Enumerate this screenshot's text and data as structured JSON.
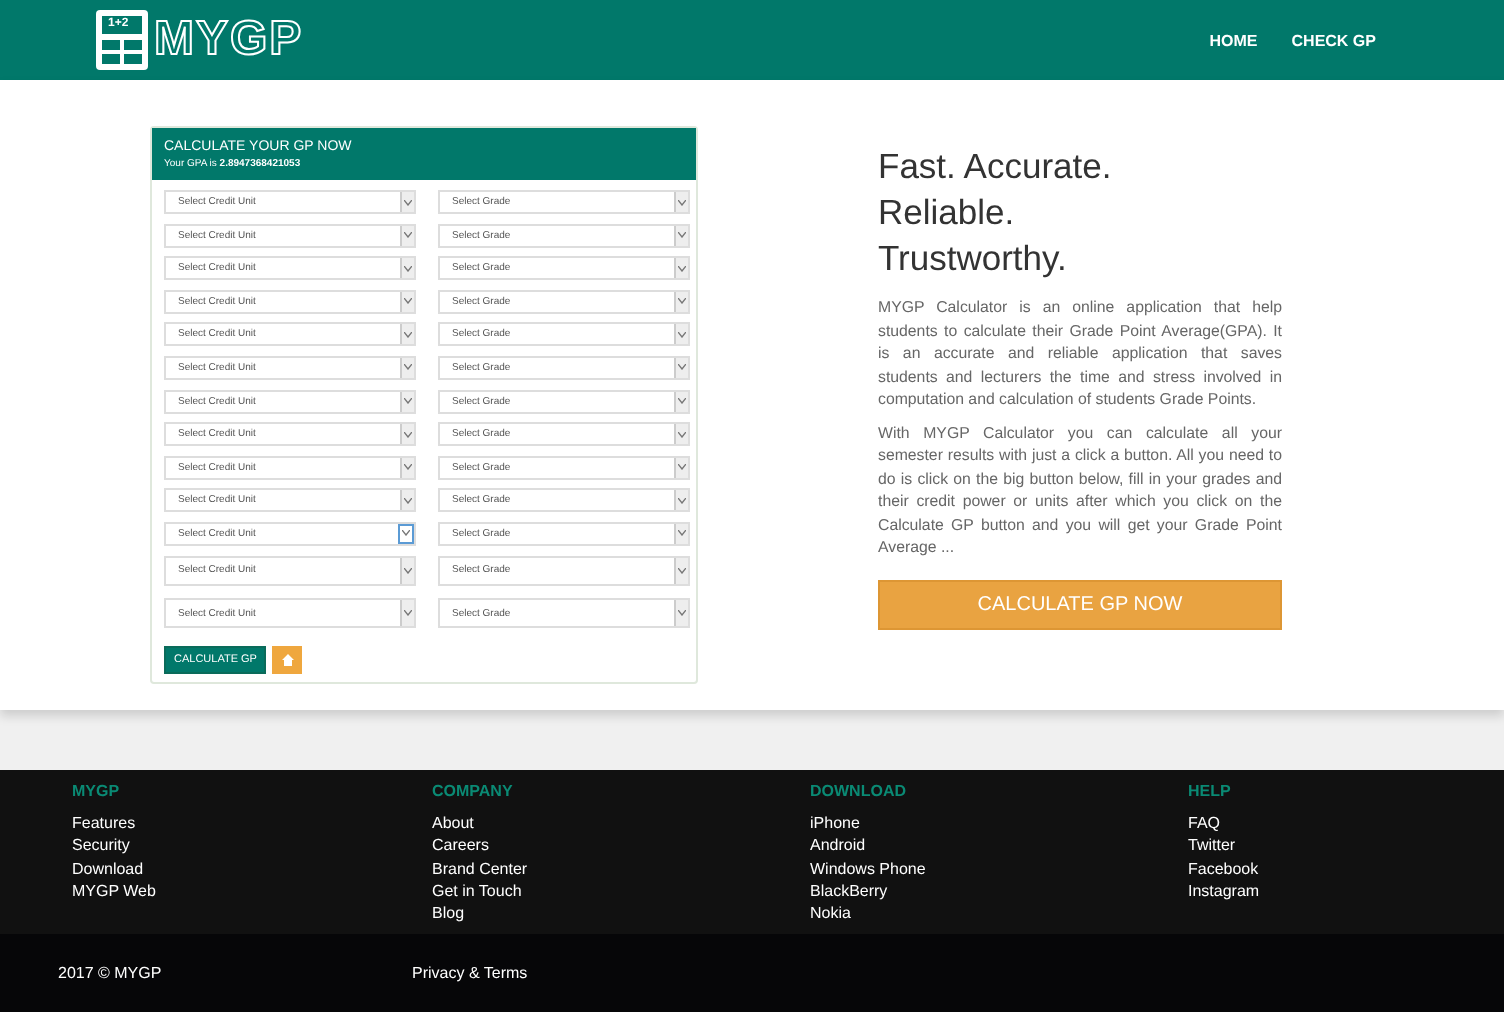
{
  "header": {
    "logo_text": "MYGP",
    "logo_icon_text": "1+2",
    "nav": [
      {
        "label": "HOME"
      },
      {
        "label": "CHECK GP"
      }
    ]
  },
  "calculator": {
    "title": "CALCULATE YOUR GP NOW",
    "gpa_label": "Your GPA is",
    "gpa_value": "2.8947368421053",
    "rows": [
      {
        "kind": "compact",
        "credit": {
          "placeholder": "Select Credit Unit",
          "focused": false
        },
        "grade": {
          "placeholder": "Select Grade",
          "focused": false
        }
      },
      {
        "kind": "compact",
        "credit": {
          "placeholder": "Select Credit Unit",
          "focused": false
        },
        "grade": {
          "placeholder": "Select Grade",
          "focused": false
        }
      },
      {
        "kind": "compact",
        "credit": {
          "placeholder": "Select Credit Unit",
          "focused": false
        },
        "grade": {
          "placeholder": "Select Grade",
          "focused": false
        }
      },
      {
        "kind": "compact",
        "credit": {
          "placeholder": "Select Credit Unit",
          "focused": false
        },
        "grade": {
          "placeholder": "Select Grade",
          "focused": false
        }
      },
      {
        "kind": "compact",
        "credit": {
          "placeholder": "Select Credit Unit",
          "focused": false
        },
        "grade": {
          "placeholder": "Select Grade",
          "focused": false
        }
      },
      {
        "kind": "compact",
        "credit": {
          "placeholder": "Select Credit Unit",
          "focused": false
        },
        "grade": {
          "placeholder": "Select Grade",
          "focused": false
        }
      },
      {
        "kind": "compact",
        "credit": {
          "placeholder": "Select Credit Unit",
          "focused": false
        },
        "grade": {
          "placeholder": "Select Grade",
          "focused": false
        }
      },
      {
        "kind": "compact",
        "credit": {
          "placeholder": "Select Credit Unit",
          "focused": false
        },
        "grade": {
          "placeholder": "Select Grade",
          "focused": false
        }
      },
      {
        "kind": "compact",
        "credit": {
          "placeholder": "Select Credit Unit",
          "focused": false
        },
        "grade": {
          "placeholder": "Select Grade",
          "focused": false
        }
      },
      {
        "kind": "compact",
        "credit": {
          "placeholder": "Select Credit Unit",
          "focused": false
        },
        "grade": {
          "placeholder": "Select Grade",
          "focused": false
        }
      },
      {
        "kind": "compact",
        "credit": {
          "placeholder": "Select Credit Unit",
          "focused": true
        },
        "grade": {
          "placeholder": "Select Grade",
          "focused": false
        }
      },
      {
        "kind": "large",
        "credit": {
          "placeholder": "Select Credit Unit",
          "focused": false
        },
        "grade": {
          "placeholder": "Select Grade",
          "focused": false
        }
      },
      {
        "kind": "large",
        "credit": {
          "placeholder": "Select Credit Unit",
          "focused": false
        },
        "grade": {
          "placeholder": "Select Grade",
          "focused": false
        }
      }
    ],
    "submit_label": "CALCULATE GP"
  },
  "intro": {
    "headline": [
      "Fast. Accurate.",
      "Reliable.",
      "Trustworthy."
    ],
    "paragraphs": [
      "MYGP Calculator is an online application that help students to calculate their Grade Point Average(GPA). It is an accurate and reliable application that saves students and lecturers the time and stress involved in computation and calculation of students Grade Points.",
      "With MYGP Calculator you can calculate all your semester results with just a click a button. All you need to do is click on the big button below, fill in your grades and their credit power or units after which you click on the Calculate GP button and you will get your Grade Point Average ..."
    ],
    "cta_label": "CALCULATE GP NOW"
  },
  "footer": {
    "columns": [
      {
        "heading": "MYGP",
        "links": [
          "Features",
          "Security",
          "Download",
          "MYGP Web"
        ]
      },
      {
        "heading": "COMPANY",
        "links": [
          "About",
          "Careers",
          "Brand Center",
          "Get in Touch",
          "Blog"
        ]
      },
      {
        "heading": "DOWNLOAD",
        "links": [
          "iPhone",
          "Android",
          "Windows Phone",
          "BlackBerry",
          "Nokia"
        ]
      },
      {
        "heading": "HELP",
        "links": [
          "FAQ",
          "Twitter",
          "Facebook",
          "Instagram"
        ]
      }
    ],
    "copyright": "2017 © MYGP",
    "legal_link": "Privacy & Terms"
  }
}
